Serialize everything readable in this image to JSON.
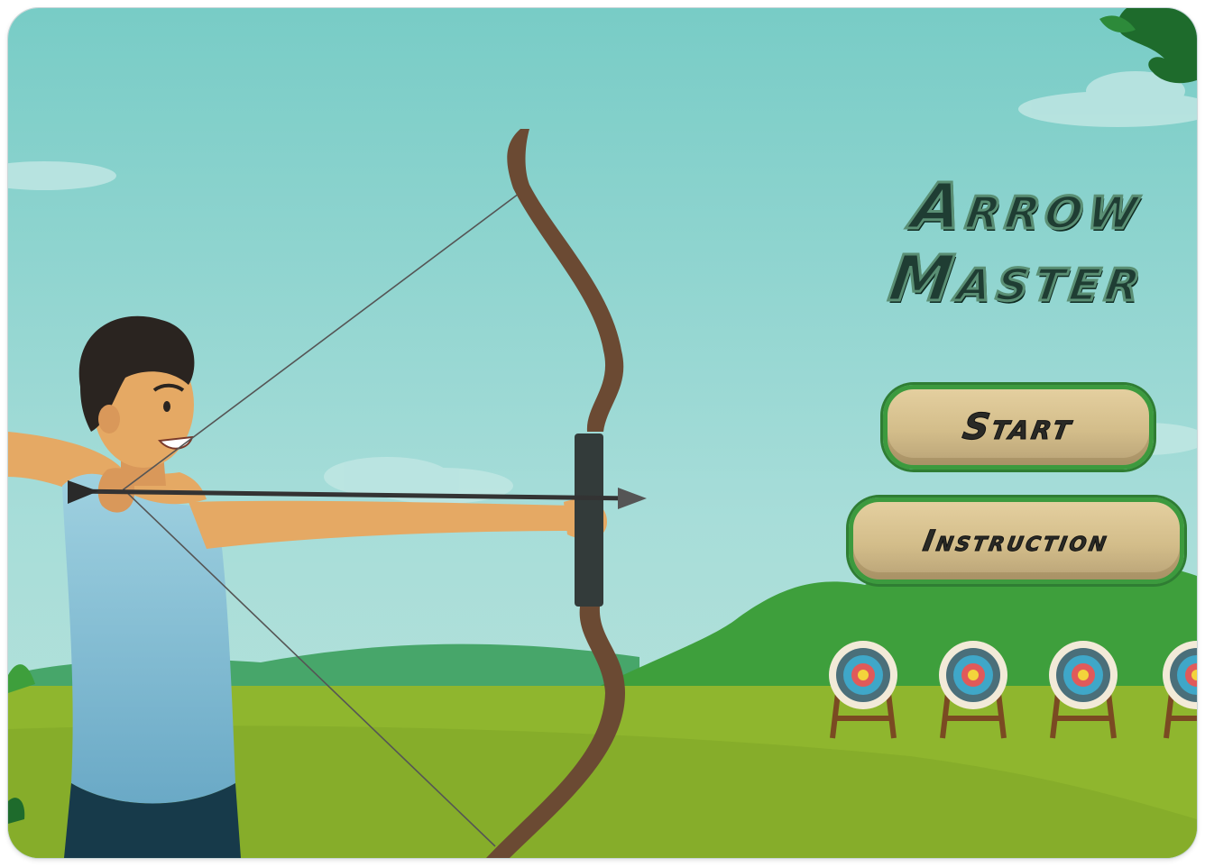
{
  "title": {
    "line1": "Arrow",
    "line2": "Master"
  },
  "menu": {
    "start_label": "Start",
    "instruction_label": "Instruction"
  },
  "colors": {
    "sky": "#87d3cc",
    "hills": "#3e9f3c",
    "grass": "#8fb62e",
    "button_fill": "#d8c190",
    "button_border": "#3c9a3e",
    "title_text": "#1f3d33"
  },
  "icons": [
    "archer-character",
    "bow-icon",
    "arrow-icon",
    "target-icon",
    "cloud-icon",
    "tree-leaves-icon"
  ]
}
